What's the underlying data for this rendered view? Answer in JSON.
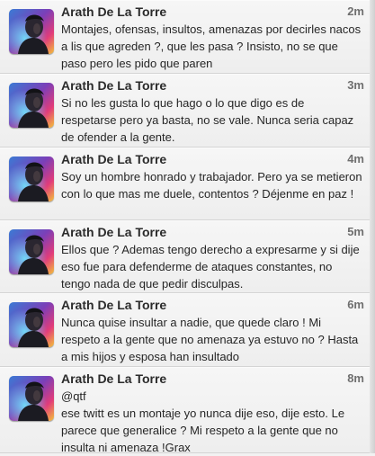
{
  "tweets": [
    {
      "author": "Arath De La Torre",
      "time": "2m",
      "mention": "",
      "text": "Montajes, ofensas, insultos, amenazas por decirles nacos a lis que agreden ?, que les pasa ? Insisto, no se que paso pero les pido que paren"
    },
    {
      "author": "Arath De La Torre",
      "time": "3m",
      "mention": "",
      "text": "Si no les gusta lo que hago o lo que digo es de respetarse pero ya basta, no se vale. Nunca seria capaz de ofender a la gente."
    },
    {
      "author": "Arath De La Torre",
      "time": "4m",
      "mention": "",
      "text": "Soy un hombre honrado y trabajador. Pero ya se metieron con lo que mas me duele, contentos ? Déjenme en paz !"
    },
    {
      "author": "Arath De La Torre",
      "time": "5m",
      "mention": "",
      "text": "Ellos que ? Ademas tengo derecho a expresarme y si dije eso fue para defenderme de ataques constantes, no tengo nada de que pedir disculpas."
    },
    {
      "author": "Arath De La Torre",
      "time": "6m",
      "mention": "",
      "text": "Nunca quise insultar a nadie, que quede claro ! Mi respeto a la gente que no amenaza ya estuvo no ? Hasta a mis hijos y esposa han insultado"
    },
    {
      "author": "Arath De La Torre",
      "time": "8m",
      "mention": "@qtf",
      "text": "ese twitt es un montaje yo nunca dije eso, dije esto. Le parece que generalice ? Mi respeto a la gente que no insulta ni amenaza !Grax"
    }
  ]
}
